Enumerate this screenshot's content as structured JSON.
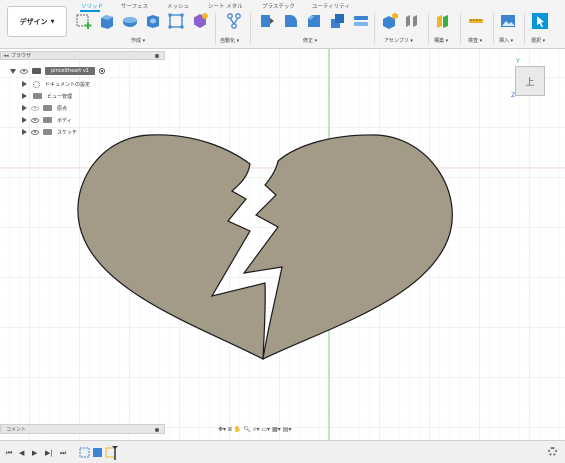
{
  "toolbar": {
    "workspace_label": "デザイン",
    "tabs": [
      "ソリッド",
      "サーフェス",
      "メッシュ",
      "シート メタル",
      "プラスチック",
      "ユーティリティ"
    ],
    "groups": [
      "作成",
      "自動化",
      "修正",
      "アセンブリ",
      "構築",
      "検査",
      "挿入",
      "選択"
    ]
  },
  "browser": {
    "title": "ブラウザ",
    "document_name": "pinceltheart v1",
    "items": [
      "ドキュメントの設定",
      "ビュー管理",
      "原点",
      "ボディ",
      "スケッチ"
    ]
  },
  "viewcube": {
    "face_label": "上",
    "axis_y": "Y",
    "axis_z": "Z"
  },
  "comments": {
    "label": "コメント"
  },
  "colors": {
    "accent": "#0696d7",
    "heart_fill": "#a39a88",
    "grid": "#e3e3e3",
    "y_axis": "#3cb043",
    "x_axis": "#e06060"
  },
  "icons": [
    "collapse-icon",
    "eye-icon",
    "folder-icon",
    "gear-icon",
    "radio-icon",
    "orbit-icon",
    "pan-icon",
    "zoom-icon",
    "display-icon",
    "grid-icon",
    "viewport-icon",
    "timeline-first-icon",
    "timeline-prev-icon",
    "timeline-play-icon",
    "timeline-next-icon",
    "timeline-last-icon",
    "settings-icon"
  ]
}
